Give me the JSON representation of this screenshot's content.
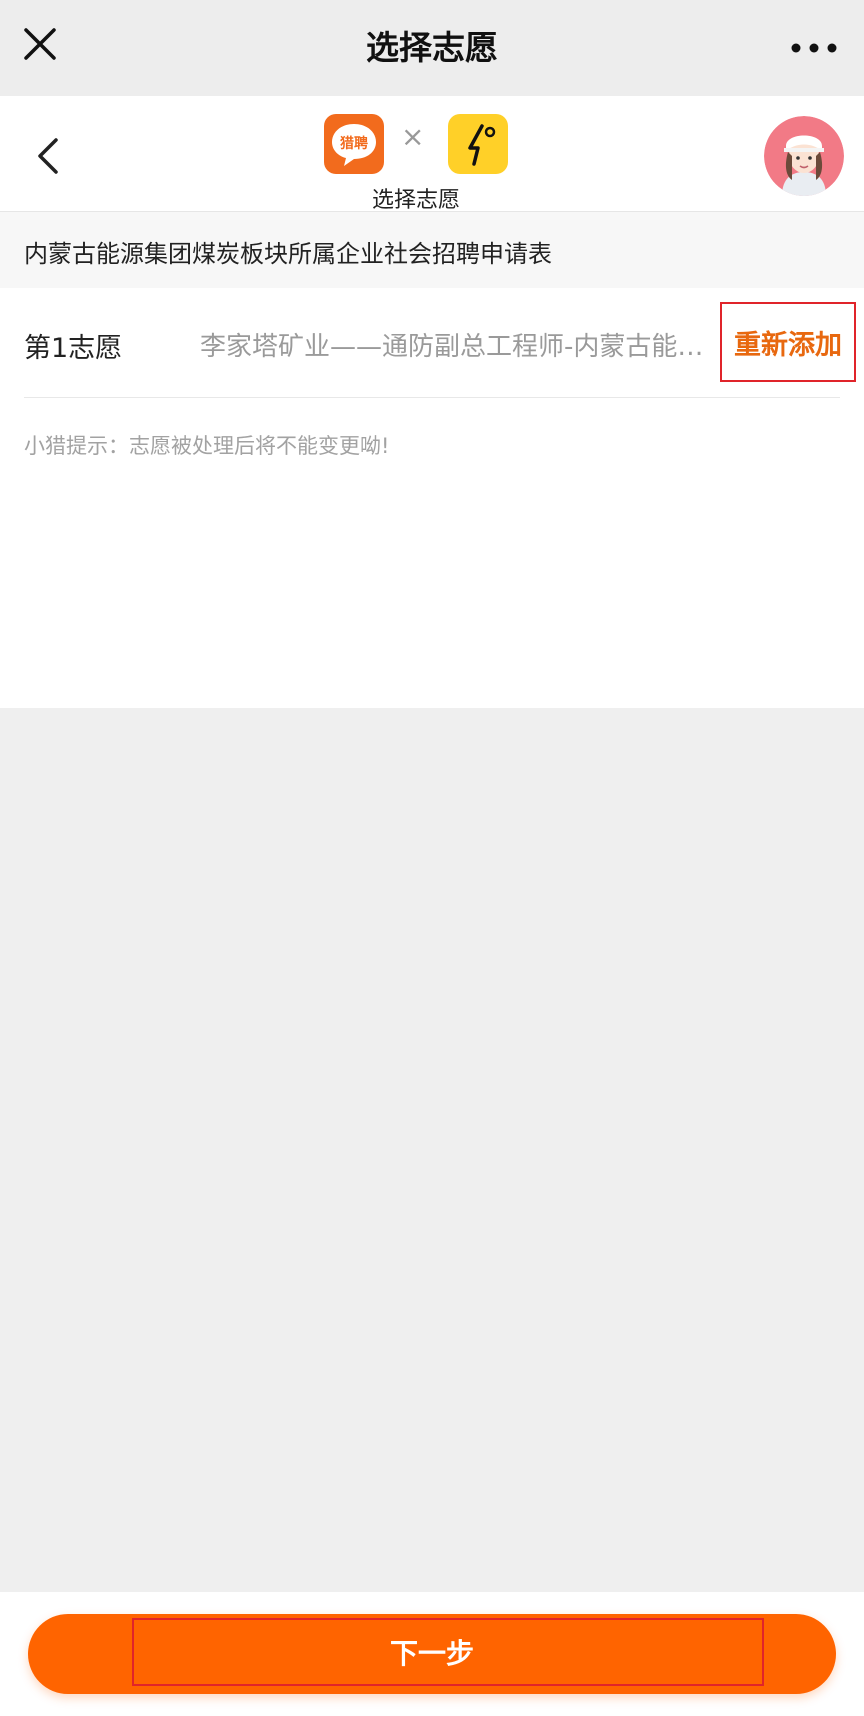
{
  "window": {
    "title": "选择志愿"
  },
  "header": {
    "subtitle": "选择志愿",
    "logo_text": "猎聘",
    "separator": "×",
    "colors": {
      "brand_orange": "#f26b1d",
      "partner_yellow": "#ffd028"
    }
  },
  "form": {
    "title": "内蒙古能源集团煤炭板块所属企业社会招聘申请表"
  },
  "choices": [
    {
      "label": "第1志愿",
      "value": "李家塔矿业——通防副总工程师-内蒙古能源集团煤炭板块所属企业",
      "action_label": "重新添加"
    }
  ],
  "hint": "小猎提示：志愿被处理后将不能变更呦!",
  "footer": {
    "next_label": "下一步",
    "accent": "#ff6400"
  }
}
